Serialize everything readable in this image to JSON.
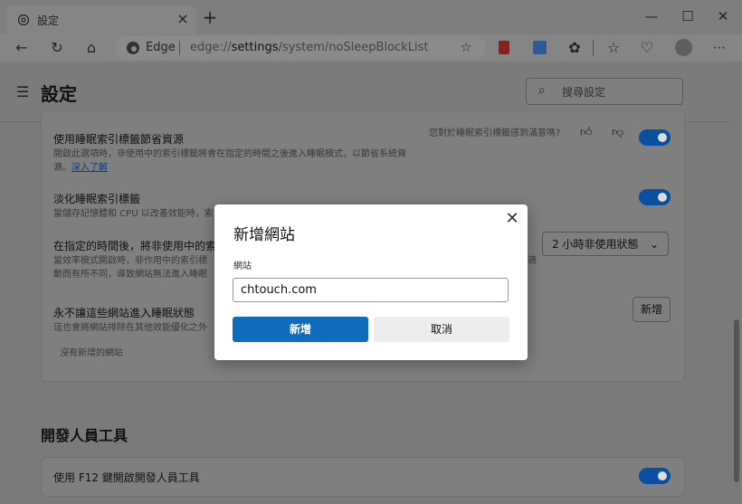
{
  "browser": {
    "tab_title": "設定",
    "tab_close": "×",
    "new_tab": "+",
    "win_minimize": "—",
    "win_maximize": "☐",
    "win_close": "✕",
    "address_label": "Edge",
    "url_prefix": "edge://",
    "url_host": "settings",
    "url_path": "/system/noSleepBlockList"
  },
  "header": {
    "title": "設定",
    "search_placeholder": "搜尋設定"
  },
  "settings": {
    "sleeping_tabs": {
      "label": "使用睡眠索引標籤節省資源",
      "desc_line1": "開啟此選項時，非使用中的索引標籤將會在指定的時間之後進入睡眠模式，以節省系統資",
      "desc_line2": "源。",
      "learn_more": "深入了解",
      "feedback": "您對於睡眠索引標籤感到滿意嗎?"
    },
    "fade_tabs": {
      "label": "淡化睡眠索引標籤",
      "desc": "當儲存記憶體和 CPU 以改善效能時，索"
    },
    "timeout": {
      "label": "在指定的時間後，將非使用中的索",
      "desc_line1": "當效率模式開啟時，非作用中的索引標",
      "desc_line1_tail": "適",
      "desc_line2": "動而有所不同，導致網站無法進入睡眠",
      "select_value": "2 小時非使用狀態"
    },
    "never_sleep": {
      "label": "永不讓這些網站進入睡眠狀態",
      "desc": "這也會將網站排除在其他效能優化之外",
      "add_button": "新增",
      "empty_text": "沒有新增的網站"
    },
    "dev_section_title": "開發人員工具",
    "dev_f12": {
      "label": "使用 F12 鍵開啟開發人員工具"
    }
  },
  "dialog": {
    "title": "新增網站",
    "field_label": "網站",
    "field_value": "chtouch.com",
    "add_label": "新增",
    "cancel_label": "取消",
    "close": "✕"
  },
  "colors": {
    "accent": "#0f6cbd",
    "toggle_on": "#0a4fa0",
    "overlay": "#7a7a7a"
  }
}
